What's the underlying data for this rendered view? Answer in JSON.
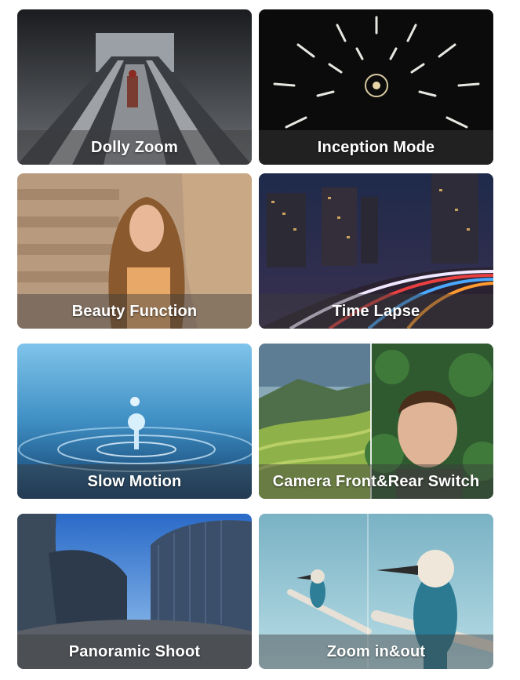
{
  "tiles": [
    {
      "label": "Dolly Zoom"
    },
    {
      "label": "Inception Mode"
    },
    {
      "label": "Beauty Function"
    },
    {
      "label": "Time Lapse"
    },
    {
      "label": "Slow Motion"
    },
    {
      "label": "Camera Front&Rear Switch"
    },
    {
      "label": "Panoramic Shoot"
    },
    {
      "label": "Zoom in&out"
    }
  ]
}
